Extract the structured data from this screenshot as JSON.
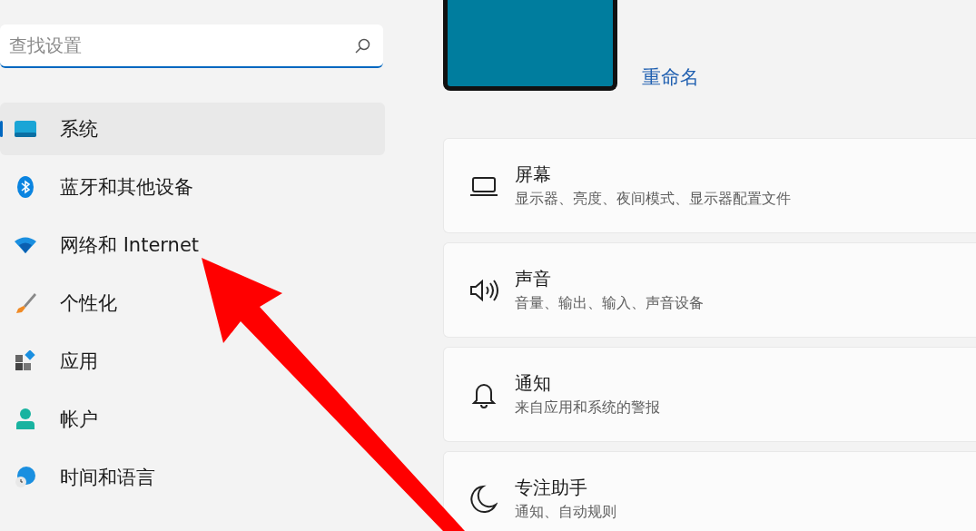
{
  "search": {
    "placeholder": "查找设置"
  },
  "nav_items": [
    {
      "kind": "system",
      "label": "系统",
      "selected": true
    },
    {
      "kind": "bluetooth",
      "label": "蓝牙和其他设备",
      "selected": false
    },
    {
      "kind": "network",
      "label": "网络和 Internet",
      "selected": false
    },
    {
      "kind": "personalize",
      "label": "个性化",
      "selected": false
    },
    {
      "kind": "apps",
      "label": "应用",
      "selected": false
    },
    {
      "kind": "accounts",
      "label": "帐户",
      "selected": false
    },
    {
      "kind": "time",
      "label": "时间和语言",
      "selected": false
    }
  ],
  "device": {
    "rename_link": "重命名"
  },
  "setting_cards": [
    {
      "kind": "display",
      "title": "屏幕",
      "subtitle": "显示器、亮度、夜间模式、显示器配置文件"
    },
    {
      "kind": "sound",
      "title": "声音",
      "subtitle": "音量、输出、输入、声音设备"
    },
    {
      "kind": "notifications",
      "title": "通知",
      "subtitle": "来自应用和系统的警报"
    },
    {
      "kind": "focus",
      "title": "专注助手",
      "subtitle": "通知、自动规则"
    }
  ]
}
